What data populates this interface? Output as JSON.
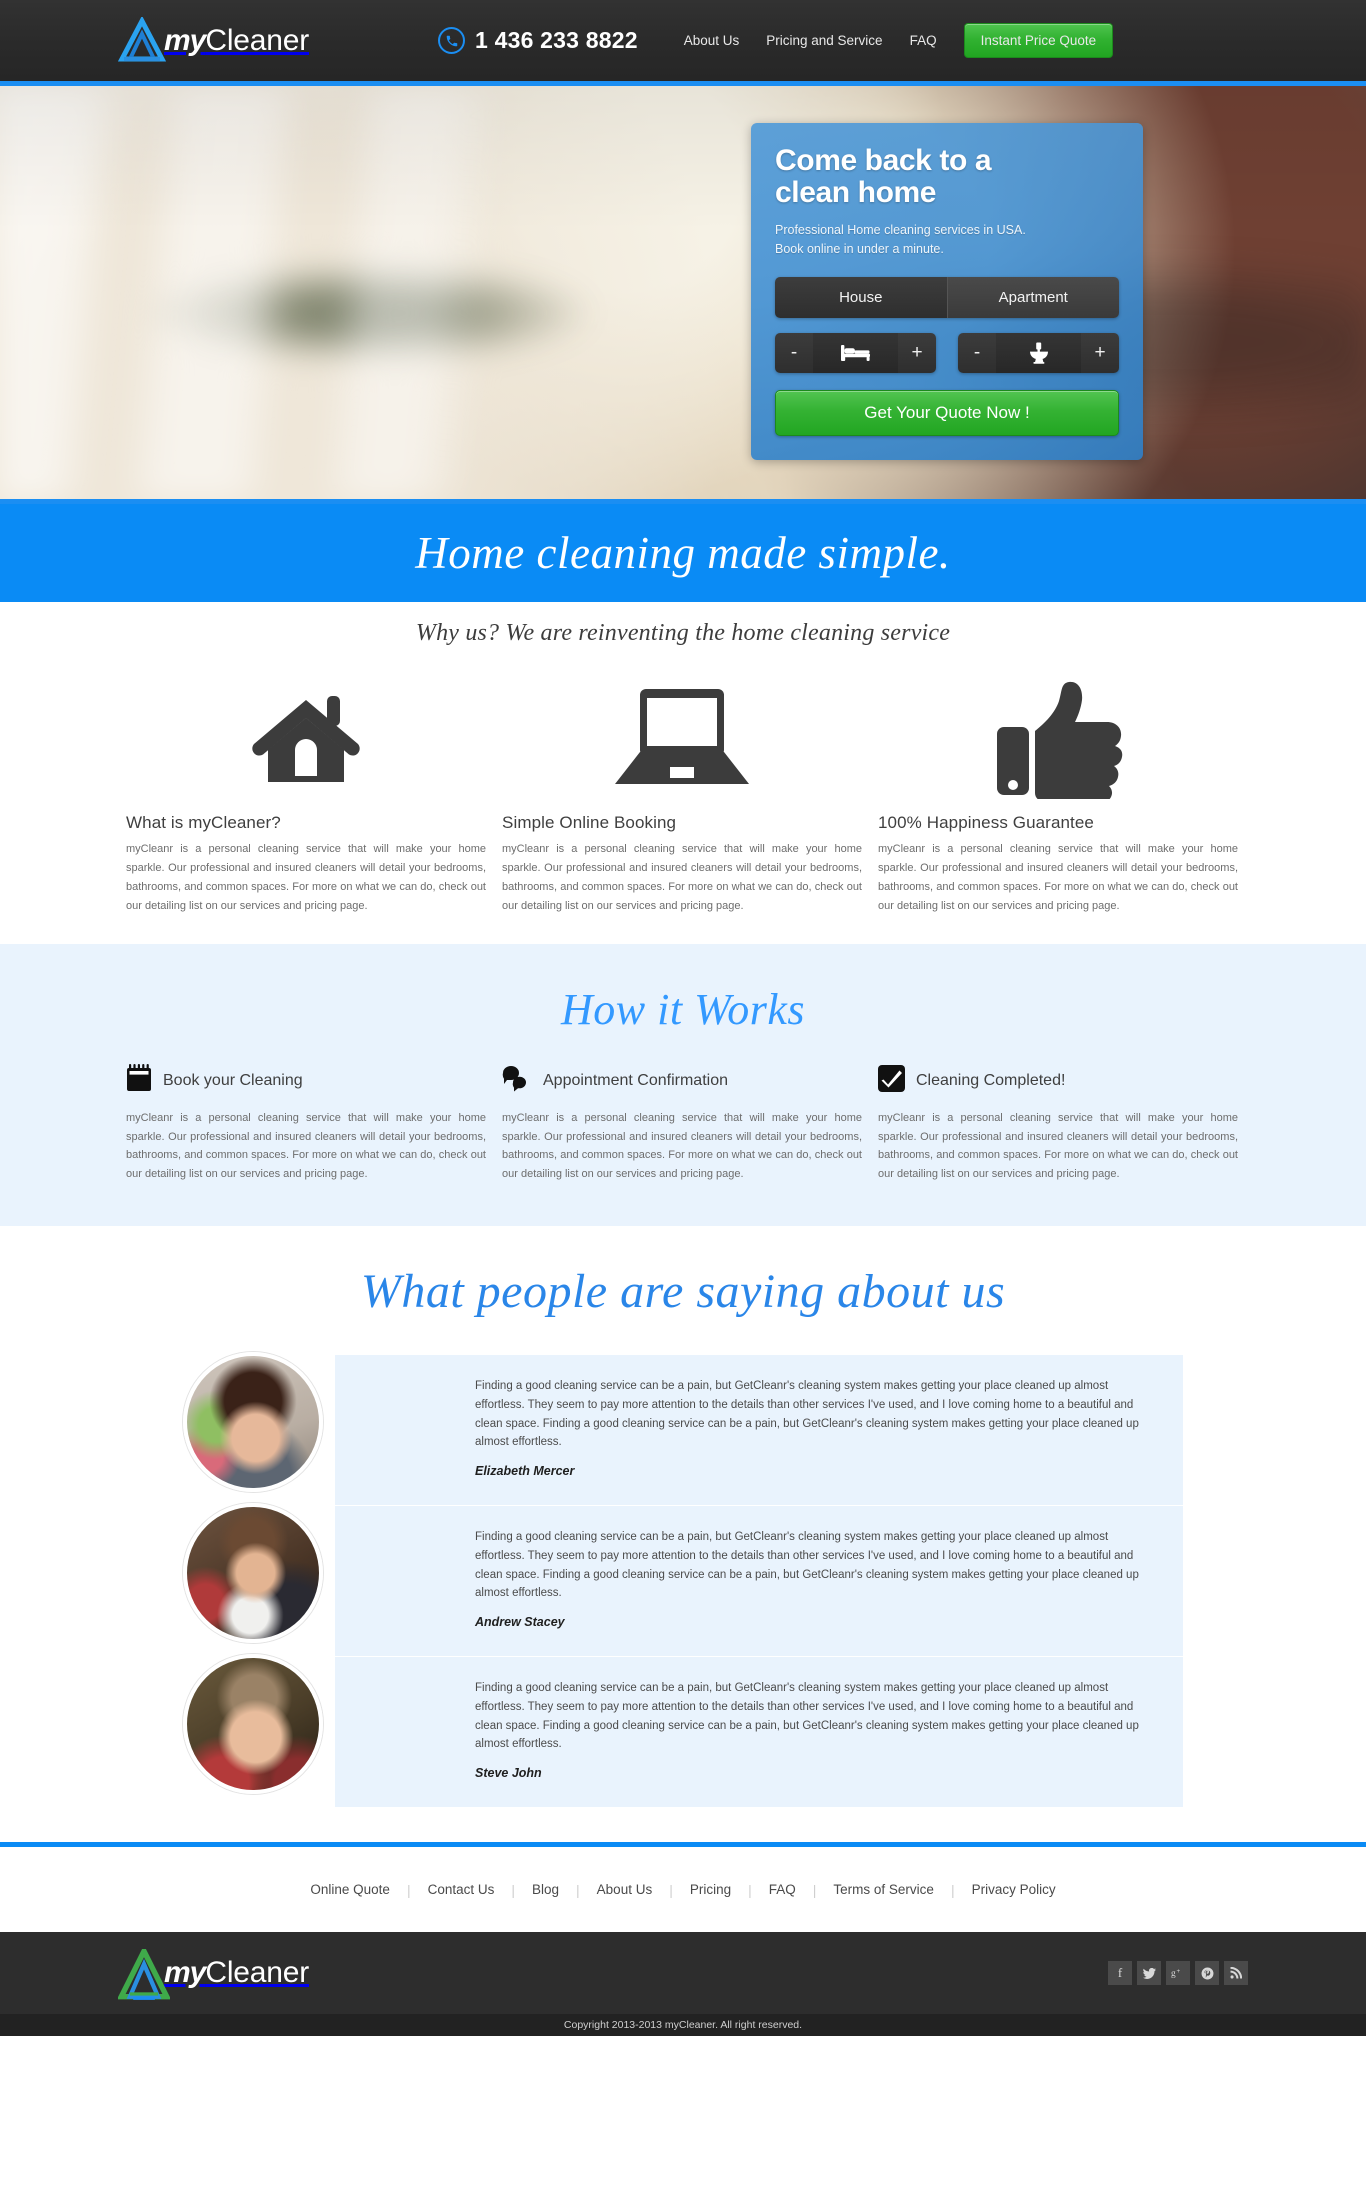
{
  "brand": {
    "name_prefix": "my",
    "name_suffix": "Cleaner",
    "logo_icon": "triangle-mountain-logo",
    "accent_blue": "#0a8bf5",
    "accent_green": "#31b231",
    "dark": "#2b2b2b"
  },
  "header": {
    "phone_icon": "phone-circle-icon",
    "phone": "1 436 233 8822",
    "nav": [
      {
        "label": "About Us"
      },
      {
        "label": "Pricing and Service"
      },
      {
        "label": "FAQ"
      }
    ],
    "cta_label": "Instant Price Quote"
  },
  "hero": {
    "background": "blurred-living-room-photo",
    "card": {
      "title_line1": "Come back to a",
      "title_line2": "clean home",
      "sub_line1": "Professional Home cleaning services in USA.",
      "sub_line2": "Book online in under a minute.",
      "property_types": [
        {
          "label": "House",
          "selected": true
        },
        {
          "label": "Apartment",
          "selected": false
        }
      ],
      "steppers": [
        {
          "icon": "bed-icon",
          "minus": "-",
          "plus": "+"
        },
        {
          "icon": "toilet-icon",
          "minus": "-",
          "plus": "+"
        }
      ],
      "cta_label": "Get Your Quote Now !"
    }
  },
  "banner": {
    "headline": "Home cleaning made simple."
  },
  "why_us": {
    "subtitle": "Why us? We are reinventing the home cleaning service",
    "body": "myCleanr is a personal cleaning service that will make your home sparkle. Our professional and insured cleaners will detail your bedrooms, bathrooms, and common spaces. For more on what we can do, check out our detailing list on our services and pricing page.",
    "items": [
      {
        "icon": "house-icon",
        "title": "What is myCleaner?"
      },
      {
        "icon": "laptop-icon",
        "title": "Simple Online Booking"
      },
      {
        "icon": "thumbs-up-icon",
        "title": "100% Happiness Guarantee"
      }
    ]
  },
  "how_it_works": {
    "title": "How it Works",
    "body": "myCleanr is a personal cleaning service that will make your home sparkle. Our professional and insured cleaners will detail your bedrooms, bathrooms, and common spaces. For more on what we can do, check out our detailing list on our services and pricing page.",
    "steps": [
      {
        "icon": "calendar-icon",
        "title": "Book your Cleaning"
      },
      {
        "icon": "speech-bubbles-icon",
        "title": "Appointment Confirmation"
      },
      {
        "icon": "checkmark-box-icon",
        "title": "Cleaning Completed!"
      }
    ]
  },
  "testimonials": {
    "title": "What people are saying about us",
    "quote": "Finding a good cleaning service can be a pain, but GetCleanr's cleaning system makes getting your place cleaned up almost effortless. They seem to pay more attention to the details than other services I've used, and I love coming home to a beautiful and clean space. Finding a good cleaning service can be a pain, but GetCleanr's cleaning system makes getting your place cleaned up almost effortless.",
    "items": [
      {
        "name": "Elizabeth Mercer",
        "avatar": "avatar-elizabeth-mercer"
      },
      {
        "name": "Andrew Stacey",
        "avatar": "avatar-andrew-stacey"
      },
      {
        "name": "Steve John",
        "avatar": "avatar-steve-john"
      }
    ]
  },
  "footer": {
    "links": [
      {
        "label": "Online Quote"
      },
      {
        "label": "Contact Us"
      },
      {
        "label": "Blog"
      },
      {
        "label": "About Us"
      },
      {
        "label": "Pricing"
      },
      {
        "label": "FAQ"
      },
      {
        "label": "Terms of Service"
      },
      {
        "label": "Privacy Policy"
      }
    ],
    "socials": [
      {
        "icon": "facebook-icon",
        "glyph": "f"
      },
      {
        "icon": "twitter-icon",
        "glyph": "ᵛ"
      },
      {
        "icon": "google-plus-icon",
        "glyph": "g"
      },
      {
        "icon": "pinterest-icon",
        "glyph": "p"
      },
      {
        "icon": "rss-icon",
        "glyph": "◠"
      }
    ],
    "copyright": "Copyright 2013-2013 myCleaner. All right reserved."
  }
}
